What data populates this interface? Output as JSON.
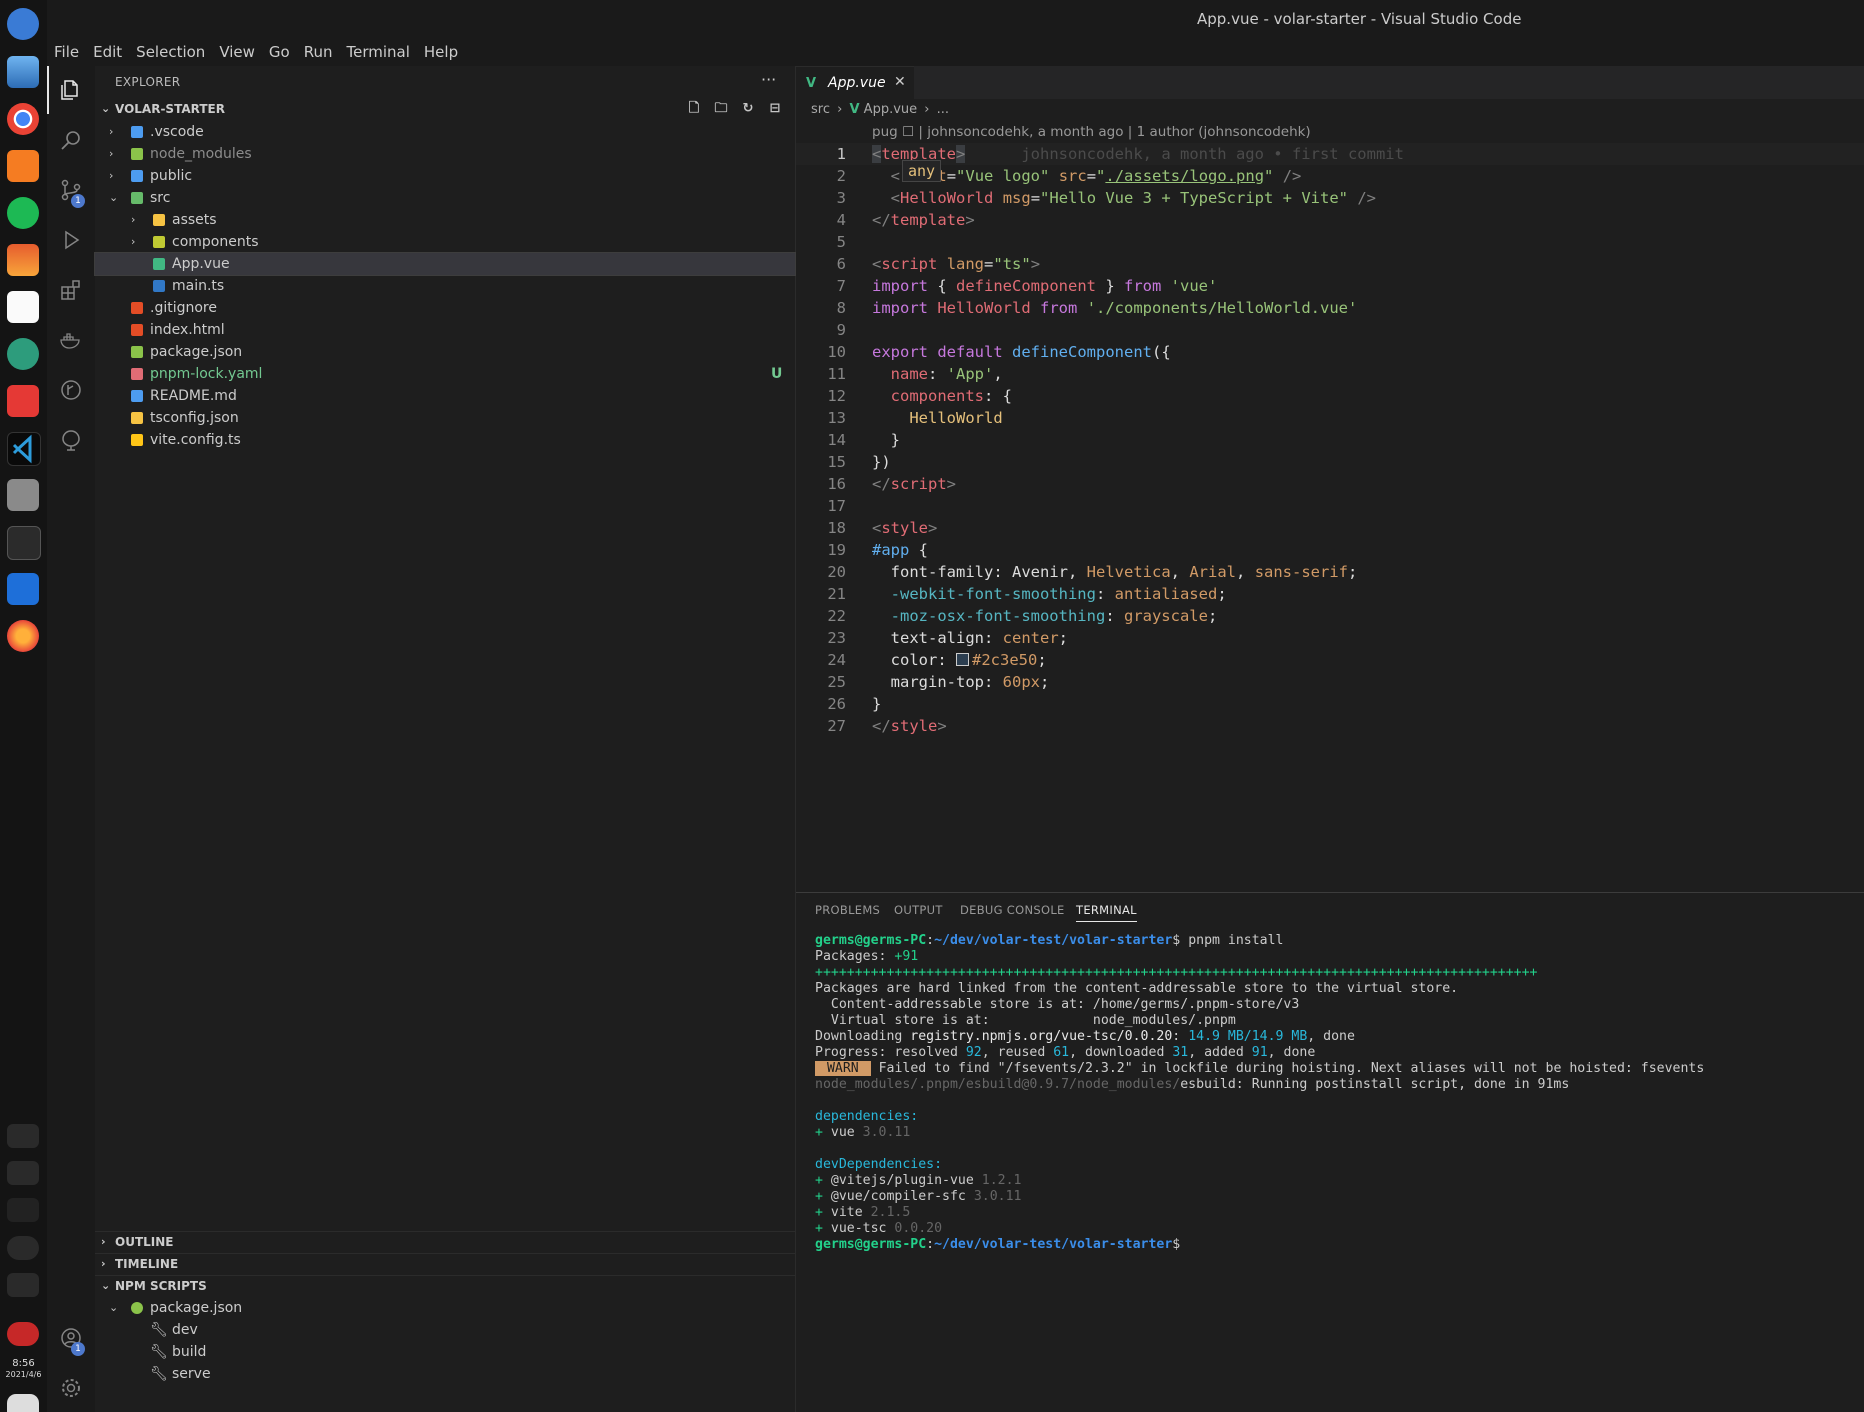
{
  "window": {
    "title": "App.vue - volar-starter - Visual Studio Code"
  },
  "menu": [
    "File",
    "Edit",
    "Selection",
    "View",
    "Go",
    "Run",
    "Terminal",
    "Help"
  ],
  "dock": {
    "icons": [
      "launcher-icon",
      "desktop-icon",
      "chrome-icon",
      "app-store-icon",
      "music-icon",
      "photos-icon",
      "calendar-icon",
      "settings-icon",
      "screen-recorder-icon",
      "vscode-icon",
      "file-manager-icon",
      "terminal-icon",
      "video-icon",
      "firefox-icon"
    ],
    "time": "8:56",
    "date": "2021/4/6"
  },
  "activity": {
    "scm_badge": "1",
    "accounts_badge": "1"
  },
  "explorer": {
    "title": "EXPLORER",
    "root": "VOLAR-STARTER",
    "items": [
      {
        "name": ".vscode",
        "type": "folder",
        "depth": 0,
        "expanded": false,
        "color": "#4d9cf0"
      },
      {
        "name": "node_modules",
        "type": "folder",
        "depth": 0,
        "expanded": false,
        "color": "#8bc34a",
        "dim": true
      },
      {
        "name": "public",
        "type": "folder",
        "depth": 0,
        "expanded": false,
        "color": "#4d9cf0"
      },
      {
        "name": "src",
        "type": "folder",
        "depth": 0,
        "expanded": true,
        "color": "#66bb6a"
      },
      {
        "name": "assets",
        "type": "folder",
        "depth": 1,
        "expanded": false,
        "color": "#f6c343"
      },
      {
        "name": "components",
        "type": "folder",
        "depth": 1,
        "expanded": false,
        "color": "#c0ca33"
      },
      {
        "name": "App.vue",
        "type": "file",
        "depth": 1,
        "color": "#41b883",
        "selected": true
      },
      {
        "name": "main.ts",
        "type": "file",
        "depth": 1,
        "color": "#3178c6"
      },
      {
        "name": ".gitignore",
        "type": "file",
        "depth": 0,
        "color": "#e44d26"
      },
      {
        "name": "index.html",
        "type": "file",
        "depth": 0,
        "color": "#e44d26"
      },
      {
        "name": "package.json",
        "type": "file",
        "depth": 0,
        "color": "#8bc34a"
      },
      {
        "name": "pnpm-lock.yaml",
        "type": "file",
        "depth": 0,
        "color": "#e06c75",
        "git": "U"
      },
      {
        "name": "README.md",
        "type": "file",
        "depth": 0,
        "color": "#4d9cf0"
      },
      {
        "name": "tsconfig.json",
        "type": "file",
        "depth": 0,
        "color": "#f6c343"
      },
      {
        "name": "vite.config.ts",
        "type": "file",
        "depth": 0,
        "color": "#ffc517"
      }
    ],
    "sections": {
      "outline": "OUTLINE",
      "timeline": "TIMELINE",
      "npm": "NPM SCRIPTS",
      "npm_file": "package.json",
      "scripts": [
        "dev",
        "build",
        "serve"
      ]
    }
  },
  "editor": {
    "tab": "App.vue",
    "breadcrumb": {
      "folder": "src",
      "file": "App.vue",
      "more": "..."
    },
    "codelens": "pug ☐ | johnsoncodehk, a month ago | 1 author (johnsoncodehk)",
    "blame": "johnsoncodehk, a month ago • first commit",
    "hover": "any",
    "line_numbers": [
      "1",
      "2",
      "3",
      "4",
      "5",
      "6",
      "7",
      "8",
      "9",
      "10",
      "11",
      "12",
      "13",
      "14",
      "15",
      "16",
      "17",
      "18",
      "19",
      "20",
      "21",
      "22",
      "23",
      "24",
      "25",
      "26",
      "27"
    ]
  },
  "panel": {
    "tabs": [
      "PROBLEMS",
      "OUTPUT",
      "DEBUG CONSOLE",
      "TERMINAL"
    ],
    "active_tab": "TERMINAL",
    "prompt_user": "germs@germs-PC",
    "prompt_path": "~/dev/volar-test/volar-starter",
    "command": "pnpm install"
  }
}
